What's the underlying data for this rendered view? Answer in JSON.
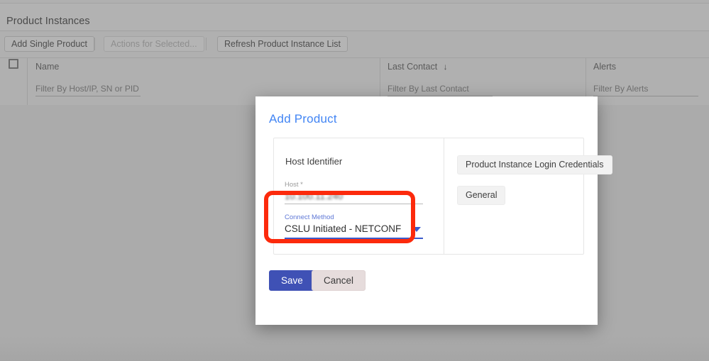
{
  "page": {
    "title": "Product Instances"
  },
  "toolbar": {
    "add_single_product": "Add Single Product",
    "actions_for_selected": "Actions for Selected...",
    "refresh_list": "Refresh Product Instance List"
  },
  "table": {
    "columns": [
      {
        "label": "Name",
        "sort_icon": "",
        "filter_placeholder": "Filter By Host/IP, SN or PID"
      },
      {
        "label": "Last Contact",
        "sort_icon": "↓",
        "filter_placeholder": "Filter By Last Contact"
      },
      {
        "label": "Alerts",
        "sort_icon": "",
        "filter_placeholder": "Filter By Alerts"
      }
    ],
    "select_all_checked": false
  },
  "modal": {
    "title": "Add Product",
    "left_panel": {
      "section_label": "Host Identifier",
      "host_field": {
        "label": "Host *",
        "value": "10.100.11.240"
      },
      "connect_method_field": {
        "label": "Connect Method",
        "value": "CSLU Initiated - NETCONF",
        "caret_icon": "chevron-down-icon"
      }
    },
    "right_panel": {
      "login_credentials_label": "Product Instance Login Credentials",
      "general_label": "General"
    },
    "actions": {
      "save": "Save",
      "cancel": "Cancel"
    }
  },
  "annotation": {
    "shape": "rounded-rectangle-highlight",
    "color": "#fc2a0c"
  },
  "colors": {
    "accent_blue": "#4285f4",
    "primary_button": "#3f51b5",
    "select_underline": "#3b5ccc",
    "annotation_red": "#fc2a0c",
    "backdrop": "#ababab"
  }
}
